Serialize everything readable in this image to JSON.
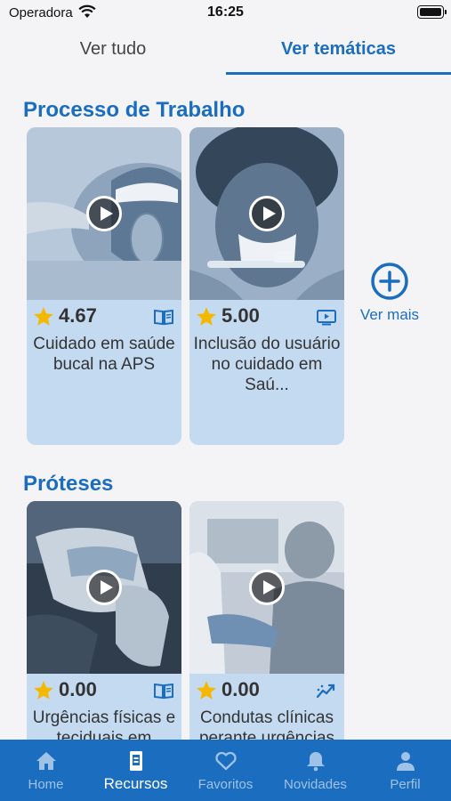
{
  "status_bar": {
    "carrier": "Operadora",
    "time": "16:25"
  },
  "tabs": [
    {
      "label": "Ver tudo",
      "active": false
    },
    {
      "label": "Ver temáticas",
      "active": true
    }
  ],
  "sections": [
    {
      "title": "Processo de Trabalho",
      "cards": [
        {
          "rating": "4.67",
          "title": "Cuidado em saúde bucal na APS",
          "type_icon": "book-icon"
        },
        {
          "rating": "5.00",
          "title": "Inclusão do usuário no cuidado em Saú...",
          "type_icon": "video-icon"
        }
      ],
      "more_label": "Ver mais"
    },
    {
      "title": "Próteses",
      "cards": [
        {
          "rating": "0.00",
          "title": "Urgências físicas e teciduais em",
          "type_icon": "book-icon"
        },
        {
          "rating": "0.00",
          "title": "Condutas clínicas perante urgências",
          "type_icon": "chart-icon"
        }
      ]
    }
  ],
  "bottom_nav": [
    {
      "label": "Home",
      "icon": "home-icon",
      "active": false
    },
    {
      "label": "Recursos",
      "icon": "resources-icon",
      "active": true
    },
    {
      "label": "Favoritos",
      "icon": "heart-icon",
      "active": false
    },
    {
      "label": "Novidades",
      "icon": "bell-icon",
      "active": false
    },
    {
      "label": "Perfil",
      "icon": "person-icon",
      "active": false
    }
  ],
  "colors": {
    "accent": "#1a6dbf",
    "card_bg": "#c4daf0",
    "star": "#f5b800",
    "nav_inactive": "#9fc3e8"
  }
}
